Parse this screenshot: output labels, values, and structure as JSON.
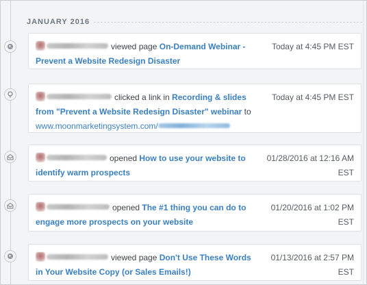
{
  "month": "JANUARY 2016",
  "events": [
    {
      "icon": "globe-icon",
      "verb": "viewed page",
      "link": "On-Demand Webinar - Prevent a Website Redesign Disaster",
      "time": "Today at 4:45 PM EST"
    },
    {
      "icon": "link-click-icon",
      "verb": "clicked a link in",
      "link": "Recording & slides from \"Prevent a Website Redesign Disaster\" webinar",
      "to": "to",
      "url": "www.moonmarketingsystem.com/",
      "time": "Today at 4:45 PM EST"
    },
    {
      "icon": "email-open-icon",
      "verb": "opened",
      "link": "How to use your website to identify warm prospects",
      "time": "01/28/2016 at 12:16 AM EST"
    },
    {
      "icon": "email-open-icon",
      "verb": "opened",
      "link": "The #1 thing you can do to engage more prospects on your website",
      "time": "01/20/2016 at 1:02 PM EST"
    },
    {
      "icon": "globe-icon",
      "verb": "viewed page",
      "link": "Don't Use These Words in Your Website Copy (or Sales Emails!)",
      "time": "01/13/2016 at 2:57 PM EST"
    }
  ]
}
